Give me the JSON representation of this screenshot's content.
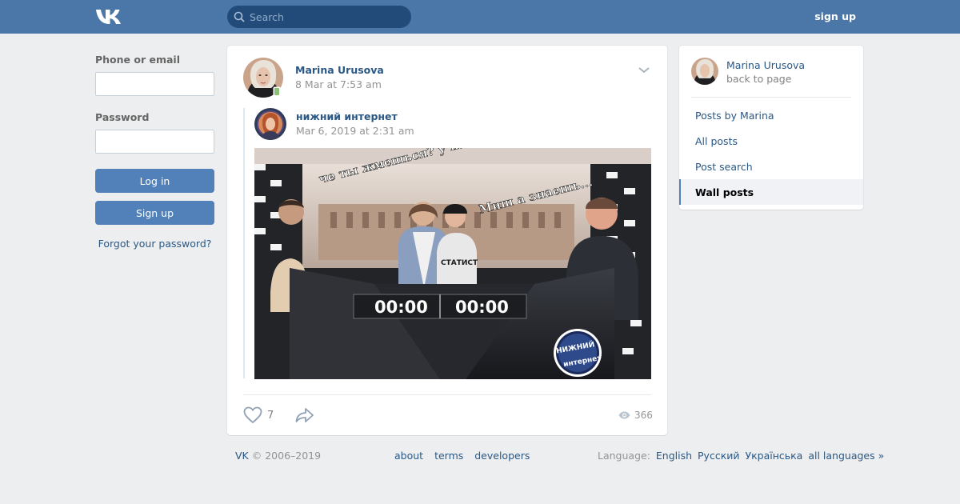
{
  "header": {
    "logo": "VK",
    "search_placeholder": "Search",
    "signup_label": "sign up"
  },
  "login": {
    "phone_label": "Phone or email",
    "password_label": "Password",
    "login_button": "Log in",
    "signup_button": "Sign up",
    "forgot_link": "Forgot your password?"
  },
  "post": {
    "author": "Marina Urusova",
    "date": "8 Mar at 7:53 am",
    "repost": {
      "author": "нижний интернет",
      "date": "Mar 6, 2019 at 2:31 am"
    },
    "image": {
      "caption_left": "че ты жмешься? у нас дебаты в прямом эфире",
      "caption_right": "Миш а знаешь...",
      "timer_left": "00:00",
      "timer_right": "00:00",
      "shirt_text": "СТАТИСТ",
      "badge_line1": "НИЖНИЙ",
      "badge_line2": "интернет"
    },
    "likes": "7",
    "views": "366"
  },
  "sidebar": {
    "name": "Marina Urusova",
    "back": "back to page",
    "items": [
      {
        "label": "Posts by Marina"
      },
      {
        "label": "All posts"
      },
      {
        "label": "Post search"
      },
      {
        "label": "Wall posts"
      }
    ]
  },
  "footer": {
    "brand": "VK",
    "copyright": "© 2006–2019",
    "links": [
      "about",
      "terms",
      "developers"
    ],
    "language_label": "Language:",
    "languages": [
      "English",
      "Русский",
      "Українська",
      "all languages »"
    ]
  },
  "colors": {
    "header": "#4a76a8",
    "button": "#5181b8",
    "link": "#2a5885",
    "background": "#edeef0"
  }
}
